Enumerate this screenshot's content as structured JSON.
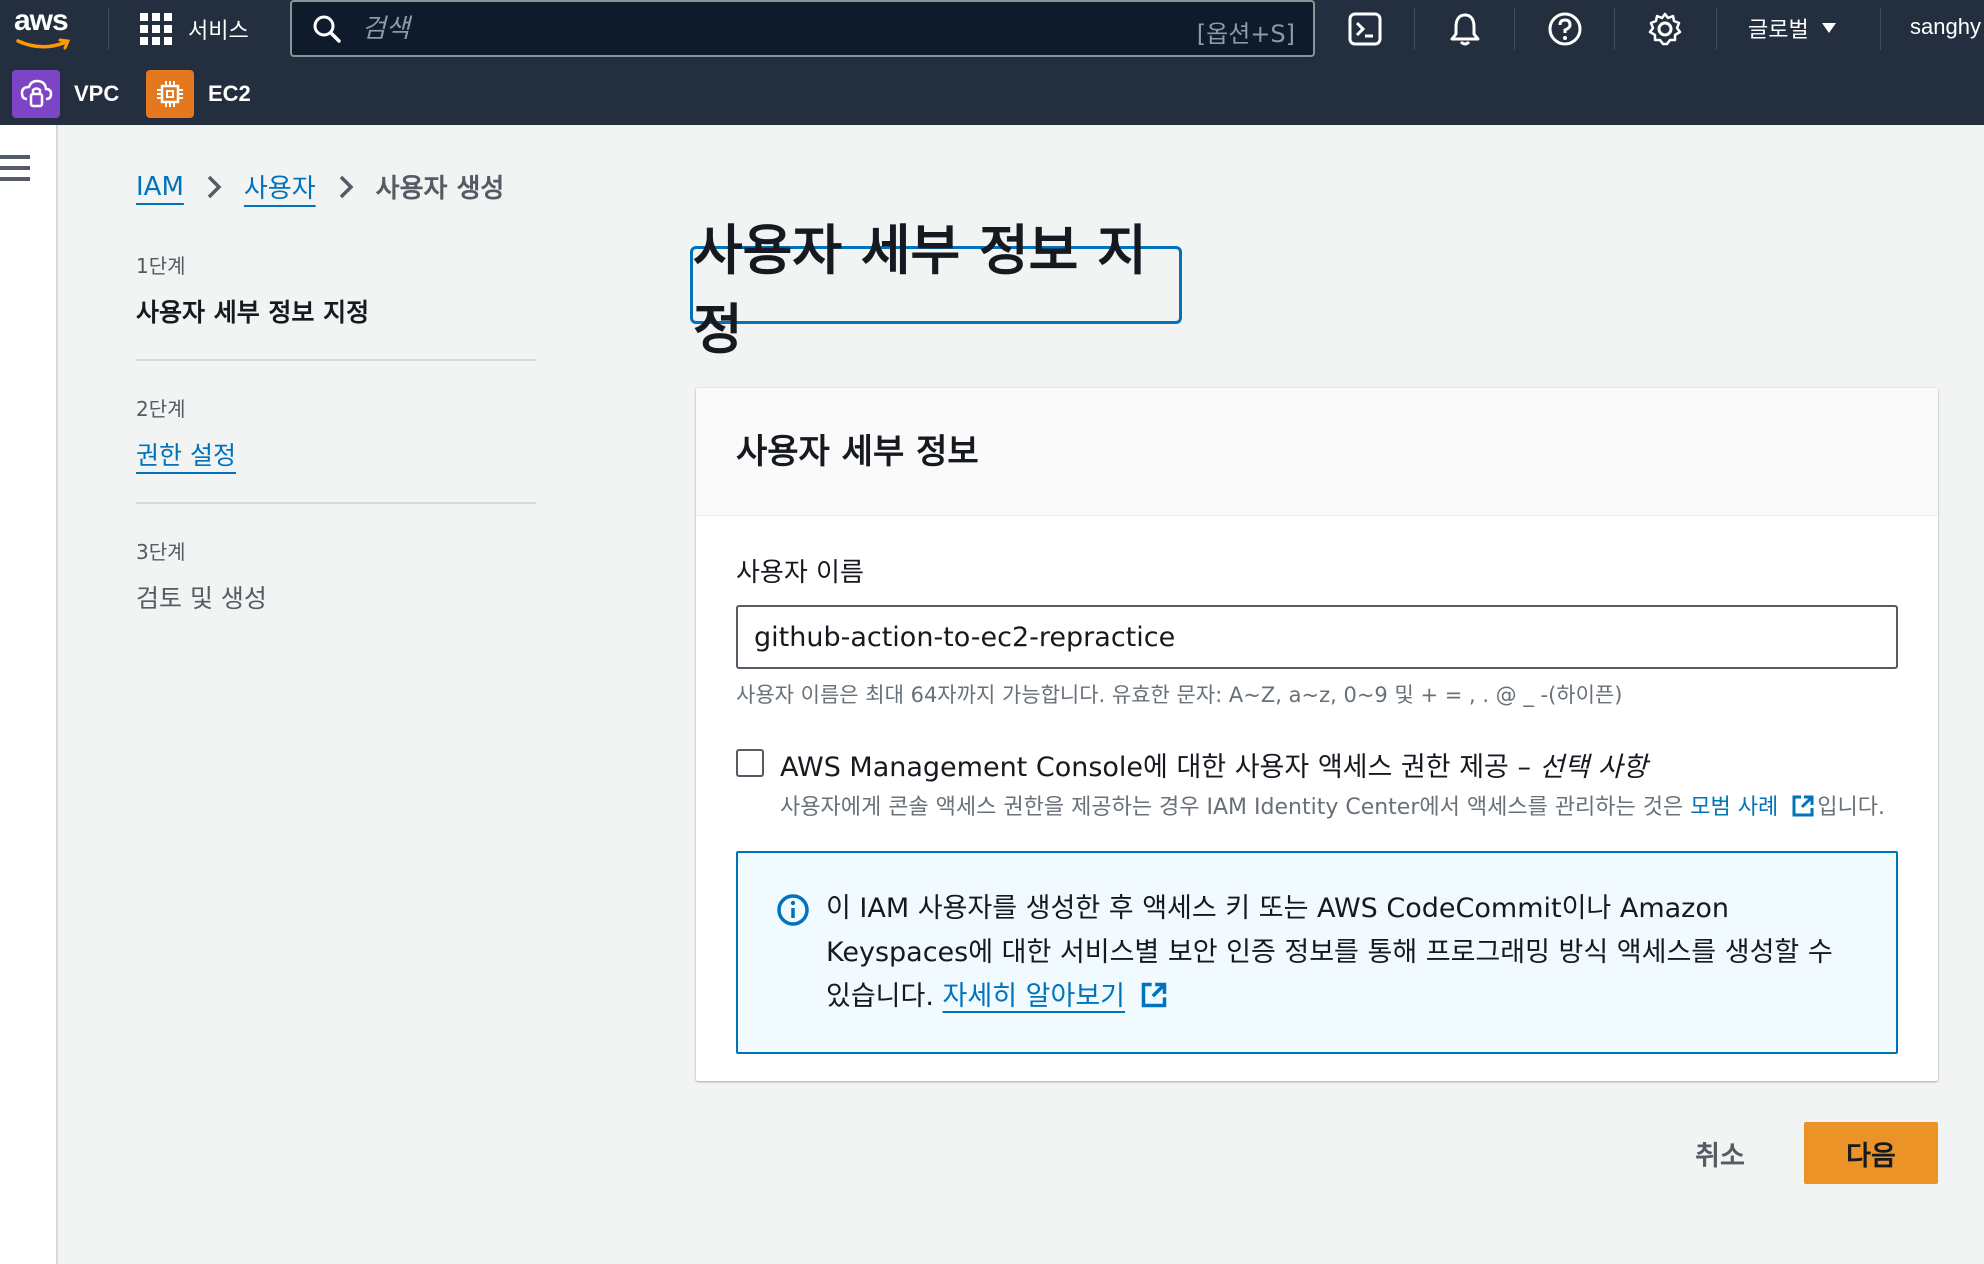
{
  "nav": {
    "logo_text": "aws",
    "services_label": "서비스",
    "search_placeholder": "검색",
    "search_shortcut": "[옵션+S]",
    "region_label": "글로벌",
    "user_label": "sanghy",
    "icons": [
      "cloudshell-icon",
      "bell-icon",
      "help-icon",
      "gear-icon"
    ]
  },
  "favorites": [
    {
      "label": "VPC",
      "color": "#7d44c5"
    },
    {
      "label": "EC2",
      "color": "#e3781e"
    }
  ],
  "breadcrumb": {
    "item1": "IAM",
    "item2": "사용자",
    "current": "사용자 생성"
  },
  "steps": [
    {
      "num": "1단계",
      "label": "사용자 세부 정보 지정"
    },
    {
      "num": "2단계",
      "label": "권한 설정"
    },
    {
      "num": "3단계",
      "label": "검토 및 생성"
    }
  ],
  "page_title": "사용자 세부 정보 지정",
  "container": {
    "title": "사용자 세부 정보",
    "username_label": "사용자 이름",
    "username_value": "github-action-to-ec2-repractice",
    "username_hint": "사용자 이름은 최대 64자까지 가능합니다. 유효한 문자: A~Z, a~z, 0~9 및 + = , . @ _ -(하이픈)",
    "console_checkbox_label": "AWS Management Console에 대한 사용자 액세스 권한 제공 – ",
    "console_checkbox_optional": "선택 사항",
    "console_desc_prefix": "사용자에게 콘솔 액세스 권한을 제공하는 경우 IAM Identity Center에서 액세스를 관리하는 것은 ",
    "console_desc_link": "모범 사례",
    "console_desc_suffix": "입니다.",
    "info_text": "이 IAM 사용자를 생성한 후 액세스 키 또는 AWS CodeCommit이나 Amazon Keyspaces에 대한 서비스별 보안 인증 정보를 통해 프로그래밍 방식 액세스를 생성할 수 있습니다. ",
    "info_link": "자세히 알아보기"
  },
  "actions": {
    "cancel": "취소",
    "next": "다음"
  },
  "colors": {
    "nav_bg": "#232f3e",
    "link": "#0073bb",
    "primary_button": "#ec9327"
  }
}
